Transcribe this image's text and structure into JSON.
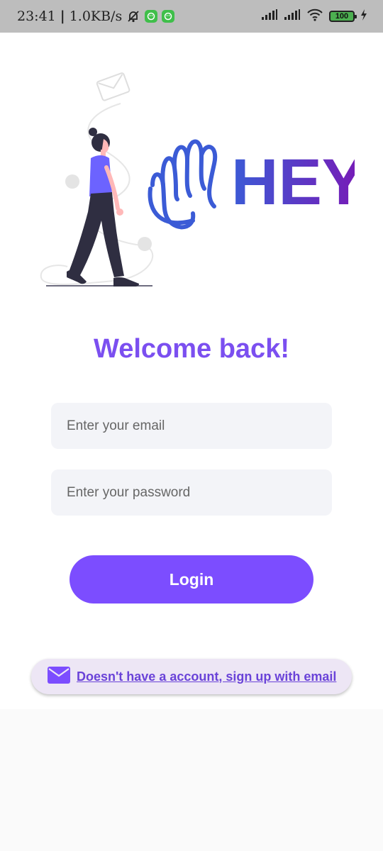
{
  "status_bar": {
    "time": "23:41",
    "net_speed": "1.0KB/s",
    "battery": "100"
  },
  "hero": {
    "logo_text": "HEY"
  },
  "title": "Welcome back!",
  "email_field": {
    "placeholder": "Enter your email",
    "value": ""
  },
  "password_field": {
    "placeholder": "Enter your password",
    "value": ""
  },
  "login_button": "Login",
  "signup_link": "Doesn't have a account, sign up with email",
  "colors": {
    "accent": "#7c4dff",
    "title": "#7b4ff0",
    "logo_start": "#3b5bd6",
    "logo_end": "#7a18b5"
  }
}
